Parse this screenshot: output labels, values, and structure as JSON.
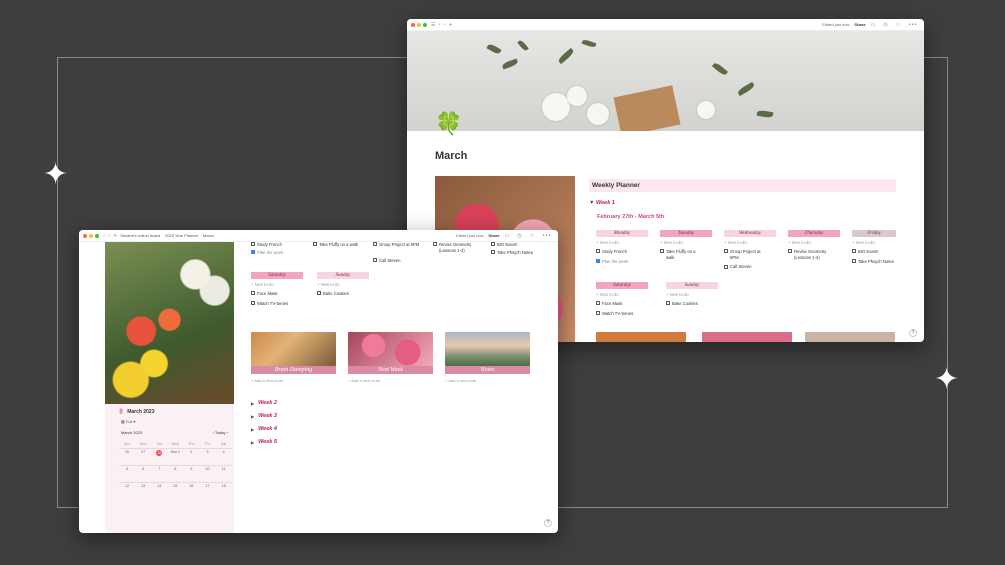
{
  "decor": {
    "sparkle_glyph": "✦"
  },
  "icons": {
    "traffic": [
      "close",
      "minimize",
      "zoom"
    ],
    "nav_back": "‹",
    "nav_fwd": "›",
    "plus": "+",
    "more": "•••",
    "comment": "comment-icon",
    "clock": "clock-icon",
    "star": "☆",
    "clover": "🍀",
    "tulip": "🌷",
    "calendar": "📅",
    "checkbox": "checkbox-icon"
  },
  "window_back": {
    "status": "Edited just now",
    "share": "Share",
    "page_title": "March",
    "planner_heading": "Weekly Planner",
    "week1_label": "Week 1",
    "date_range": "February 27th  - March 5th",
    "new_todo": "+ New to-do",
    "days": [
      {
        "name": "Monday",
        "todos": [
          {
            "text": "Study French",
            "checked": false
          },
          {
            "text": "Plan the week",
            "checked": true
          }
        ]
      },
      {
        "name": "Tuesday",
        "todos": [
          {
            "text": "Take Fluffy on a walk",
            "checked": false
          }
        ]
      },
      {
        "name": "Wednesday",
        "todos": [
          {
            "text": "Group Project at 5PM",
            "checked": false
          },
          {
            "text": "Call Steven",
            "checked": false
          }
        ]
      },
      {
        "name": "Thursday",
        "todos": [
          {
            "text": "Revise Geometry (Lessons 1-4)",
            "checked": false
          }
        ]
      },
      {
        "name": "Friday",
        "todos": [
          {
            "text": "BIO Exam!",
            "checked": false
          },
          {
            "text": "Take Phsych Notes",
            "checked": false
          }
        ]
      },
      {
        "name": "Saturday",
        "todos": [
          {
            "text": "Face Mask",
            "checked": false
          },
          {
            "text": "Watch TV-Series",
            "checked": false
          }
        ]
      },
      {
        "name": "Sunday",
        "todos": [
          {
            "text": "Bake Cookies",
            "checked": false
          }
        ]
      }
    ],
    "help": "?"
  },
  "window_front": {
    "breadcrumbs": [
      "Student's notion board",
      "2023 Year Planner",
      "March"
    ],
    "status": "Edited just now",
    "share": "Share",
    "sidebar": {
      "calendar_title": "March 2023",
      "view_label": "Full",
      "month_label": "March 2023",
      "today_label": "Today",
      "weekday_headers": [
        "Sun",
        "Mon",
        "Tue",
        "Wed",
        "Thu",
        "Fri",
        "Sat"
      ],
      "rows": [
        [
          "26",
          "27",
          "28",
          "Mar 1",
          "2",
          "3",
          "4"
        ],
        [
          "5",
          "6",
          "7",
          "8",
          "9",
          "10",
          "11"
        ],
        [
          "12",
          "13",
          "14",
          "15",
          "16",
          "17",
          "18"
        ]
      ],
      "today_day": "28"
    },
    "top_todos": [
      {
        "text": "Study French",
        "checked": false
      },
      {
        "text": "Plan the week",
        "checked": true
      },
      {
        "text": "Take Fluffy on a walk",
        "checked": false
      },
      {
        "text": "Group Project at 5PM",
        "checked": false
      },
      {
        "text": "Call Steven",
        "checked": false
      },
      {
        "text": "Revise Geometry (Lessons 1-4)",
        "checked": false
      },
      {
        "text": "BIO Exam!",
        "checked": false
      },
      {
        "text": "Take Phsych Notes",
        "checked": false
      }
    ],
    "weekend": [
      {
        "name": "Saturday",
        "new_todo": "+ New to-do",
        "todos": [
          {
            "text": "Face Mask",
            "checked": false
          },
          {
            "text": "Watch TV-Series",
            "checked": false
          }
        ]
      },
      {
        "name": "Sunday",
        "new_todo": "+ New to-do",
        "todos": [
          {
            "text": "Bake Cookies",
            "checked": false
          }
        ]
      }
    ],
    "gallery": [
      {
        "label": "Brain Dumping",
        "add": "+ Add a new to-do"
      },
      {
        "label": "Next Week",
        "add": "+ Add a new to-do"
      },
      {
        "label": "Notes",
        "add": "+ Add a new note"
      }
    ],
    "weeks": [
      "Week 2",
      "Week 3",
      "Week 4",
      "Week 5"
    ],
    "help": "?"
  }
}
